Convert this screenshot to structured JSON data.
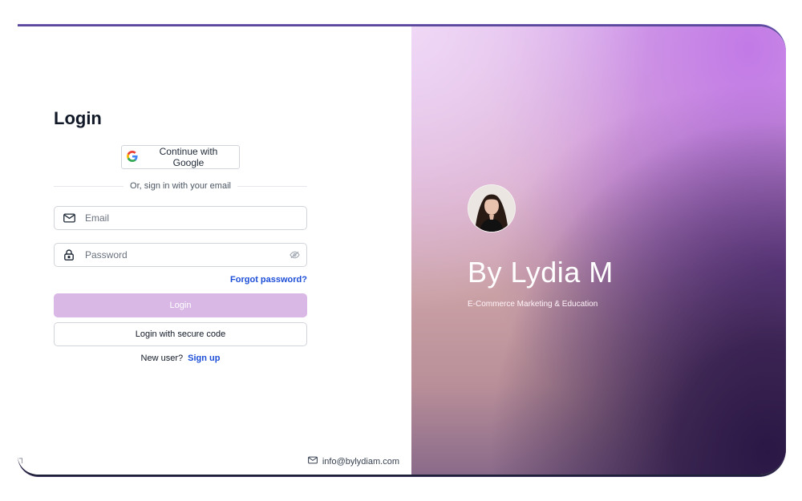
{
  "login": {
    "title": "Login",
    "google_button": "Continue with Google",
    "divider_text": "Or, sign in with your email",
    "email_placeholder": "Email",
    "password_placeholder": "Password",
    "forgot_password": "Forgot password?",
    "login_button": "Login",
    "secure_code_button": "Login with secure code",
    "new_user_text": "New user?",
    "sign_up_link": "Sign up"
  },
  "footer": {
    "email": "info@bylydiam.com",
    "left_mark": "┐"
  },
  "brand": {
    "name": "By Lydia M",
    "tagline": "E-Commerce Marketing & Education"
  },
  "colors": {
    "login_button_bg": "#d9b8e6",
    "link": "#1d4ed8",
    "heading": "#111827"
  },
  "icons": {
    "google": "google-icon",
    "email": "mail-icon",
    "password": "lock-icon",
    "visibility": "eye-off-icon",
    "footer_email": "mail-icon"
  }
}
